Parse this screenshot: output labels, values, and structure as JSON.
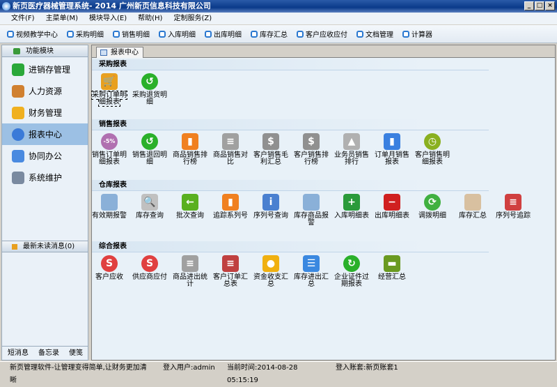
{
  "title": "新页医疗器械管理系统- 2014 广州新页信息科技有限公司",
  "menu": [
    "文件(F)",
    "主菜单(M)",
    "模块导入(E)",
    "帮助(H)",
    "定制服务(Z)"
  ],
  "toolbar": [
    "视频教学中心",
    "采购明细",
    "销售明细",
    "入库明细",
    "出库明细",
    "库存汇总",
    "客户应收应付",
    "文档管理",
    "计算器"
  ],
  "sidebar": {
    "header": "功能模块",
    "items": [
      {
        "label": "进销存管理",
        "color": "#2aa83a"
      },
      {
        "label": "人力资源",
        "color": "#d08030"
      },
      {
        "label": "财务管理",
        "color": "#f0b020"
      },
      {
        "label": "报表中心",
        "color": "#3a7ad8",
        "selected": true
      },
      {
        "label": "协同办公",
        "color": "#4a8ae0"
      },
      {
        "label": "系统维护",
        "color": "#7a8aa0"
      }
    ],
    "messages": "最新未读消息(0)",
    "footer": [
      "短消息",
      "备忘录",
      "便笺"
    ]
  },
  "tab": "报表中心",
  "sections": [
    {
      "title": "采购报表",
      "items": [
        {
          "label": "采购订单明细报表",
          "icon": "cart-icon",
          "color": "#e8a020",
          "glyph": "🛒"
        },
        {
          "label": "采购退货明细",
          "icon": "return-icon",
          "color": "#2ab02a",
          "glyph": "↺"
        }
      ]
    },
    {
      "title": "销售报表",
      "items": [
        {
          "label": "销售订单明细报表",
          "icon": "discount-icon",
          "color": "#b070b0",
          "glyph": "-5%"
        },
        {
          "label": "销售退回明细",
          "icon": "return-icon",
          "color": "#2ab02a",
          "glyph": "↺"
        },
        {
          "label": "商品销售排行榜",
          "icon": "bar-chart-icon",
          "color": "#f08020",
          "glyph": "▮"
        },
        {
          "label": "商品销售对比",
          "icon": "document-icon",
          "color": "#a0a0a0",
          "glyph": "≡"
        },
        {
          "label": "客户销售毛利汇总",
          "icon": "dollar-icon",
          "color": "#909090",
          "glyph": "$"
        },
        {
          "label": "客户销售排行榜",
          "icon": "dollar-icon",
          "color": "#909090",
          "glyph": "$"
        },
        {
          "label": "业务员销售排行",
          "icon": "growth-chart-icon",
          "color": "#b0b0b0",
          "glyph": "▲"
        },
        {
          "label": "订单月销售报表",
          "icon": "bar-chart-icon",
          "color": "#3a80e0",
          "glyph": "▮"
        },
        {
          "label": "客户销售明细报表",
          "icon": "clock-icon",
          "color": "#8ab020",
          "glyph": "◷"
        }
      ]
    },
    {
      "title": "仓库报表",
      "items": [
        {
          "label": "有效期报警",
          "icon": "folder-icon",
          "color": "#8ab0d8",
          "glyph": ""
        },
        {
          "label": "库存查询",
          "icon": "magnifier-icon",
          "color": "#c0c0c0",
          "glyph": "🔍"
        },
        {
          "label": "批次查询",
          "icon": "arrow-left-icon",
          "color": "#5ab020",
          "glyph": "←"
        },
        {
          "label": "追踪系列号",
          "icon": "bar-chart-icon",
          "color": "#f08020",
          "glyph": "▮"
        },
        {
          "label": "序列号查询",
          "icon": "document-info-icon",
          "color": "#4a80d0",
          "glyph": "i"
        },
        {
          "label": "库存商品报警",
          "icon": "folder-icon",
          "color": "#8ab0d8",
          "glyph": ""
        },
        {
          "label": "入库明细表",
          "icon": "cart-add-icon",
          "color": "#2a9a3a",
          "glyph": "+"
        },
        {
          "label": "出库明细表",
          "icon": "cart-remove-icon",
          "color": "#d02020",
          "glyph": "−"
        },
        {
          "label": "调拨明细",
          "icon": "refresh-icon",
          "color": "#40b040",
          "glyph": "⟳"
        },
        {
          "label": "库存汇总",
          "icon": "book-icon",
          "color": "#d8c0a0",
          "glyph": ""
        },
        {
          "label": "序列号追踪",
          "icon": "document-icon",
          "color": "#d04040",
          "glyph": "≡"
        }
      ]
    },
    {
      "title": "综合报表",
      "items": [
        {
          "label": "客户应收",
          "icon": "s-circle-icon",
          "color": "#e04040",
          "glyph": "S"
        },
        {
          "label": "供应商应付",
          "icon": "s-circle-icon",
          "color": "#e04040",
          "glyph": "S"
        },
        {
          "label": "商品进出统计",
          "icon": "document-icon",
          "color": "#a0a0a0",
          "glyph": "≡"
        },
        {
          "label": "客户订单汇总表",
          "icon": "document-icon",
          "color": "#c04040",
          "glyph": "≡"
        },
        {
          "label": "资金收支汇总",
          "icon": "coins-icon",
          "color": "#f0b010",
          "glyph": "●"
        },
        {
          "label": "库存进出汇总",
          "icon": "database-icon",
          "color": "#3a88e0",
          "glyph": "☰"
        },
        {
          "label": "企业证件过期报表",
          "icon": "return-icon",
          "color": "#2ab02a",
          "glyph": "↻"
        },
        {
          "label": "经营汇总",
          "icon": "money-icon",
          "color": "#6a9a20",
          "glyph": "▬"
        }
      ]
    }
  ],
  "status": {
    "slogan": "新页管理软件-让管理变得简单,让财务更加清晰",
    "user": "登入用户:admin",
    "time": "当前时间:2014-08-28 05:15:19",
    "account": "登入账套:新页账套1"
  }
}
